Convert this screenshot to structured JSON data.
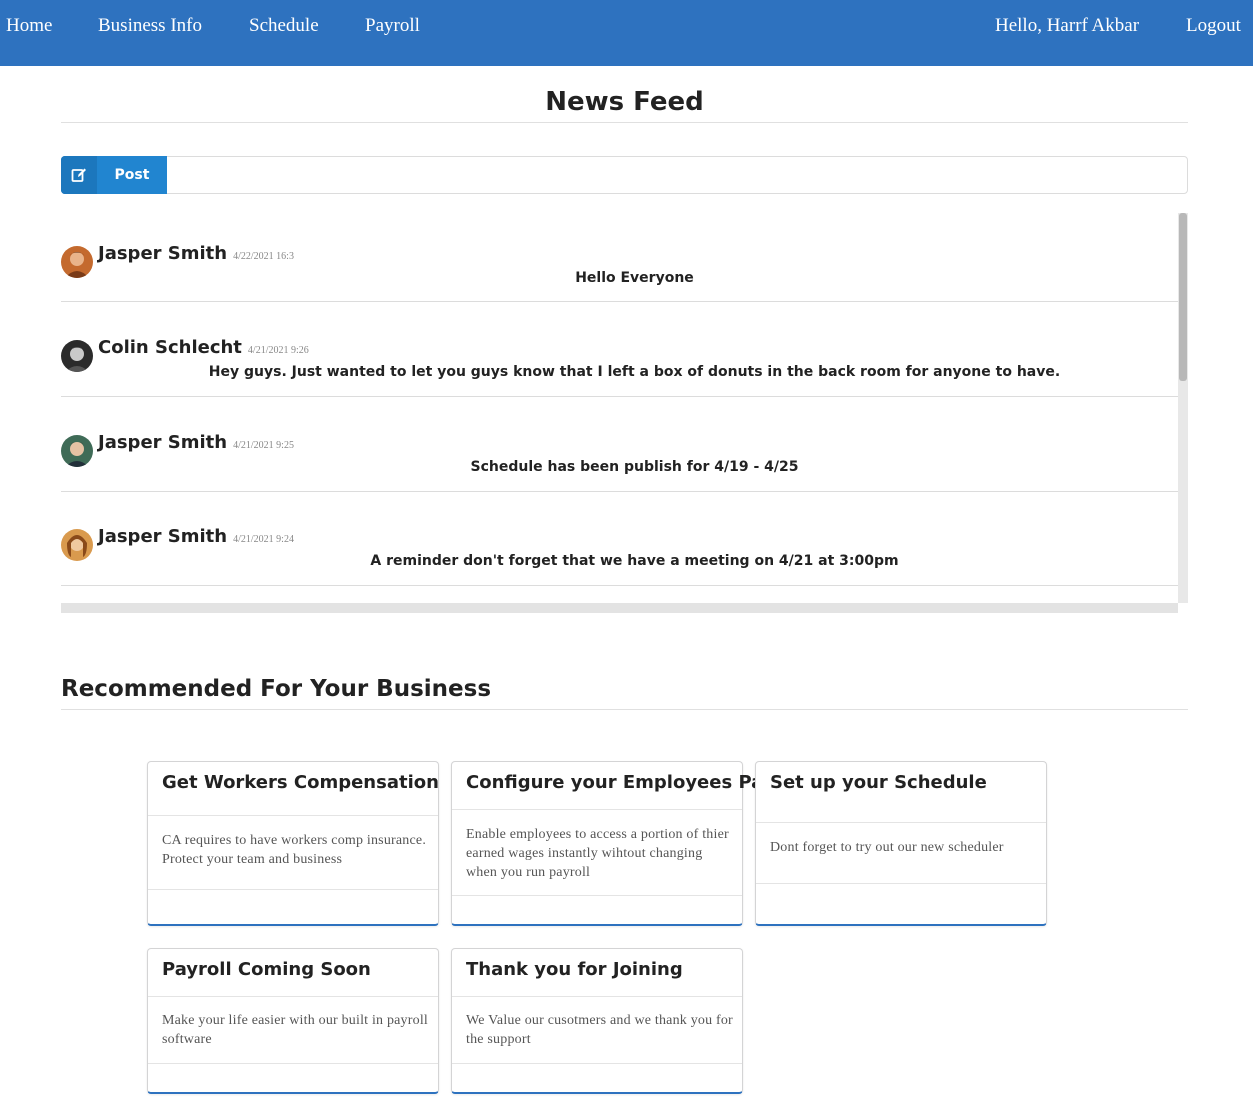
{
  "nav": {
    "home": "Home",
    "business_info": "Business Info",
    "schedule": "Schedule",
    "payroll": "Payroll",
    "greeting": "Hello, Harrf Akbar",
    "logout": "Logout"
  },
  "feed": {
    "title": "News Feed",
    "post_label": "Post",
    "posts": [
      {
        "author": "Jasper Smith",
        "time": "4/22/2021 16:3",
        "message": "Hello Everyone"
      },
      {
        "author": "Colin Schlecht",
        "time": "4/21/2021 9:26",
        "message": "Hey guys. Just wanted to let you guys know that I left a box of donuts in the back room for anyone to have."
      },
      {
        "author": "Jasper Smith",
        "time": "4/21/2021 9:25",
        "message": "Schedule has been publish for 4/19 - 4/25"
      },
      {
        "author": "Jasper Smith",
        "time": "4/21/2021 9:24",
        "message": "A reminder don't forget that we have a meeting on 4/21 at 3:00pm"
      }
    ]
  },
  "recommended": {
    "title": "Recommended For Your Business",
    "cards": [
      {
        "title": "Get Workers Compensation",
        "body": "CA requires to have workers comp insurance. Protect your team and business"
      },
      {
        "title": "Configure your Employees Pay",
        "body": "Enable employees to access a portion of thier earned wages instantly wihtout changing when you run payroll"
      },
      {
        "title": "Set up your Schedule",
        "body": "Dont forget to try out our new scheduler"
      },
      {
        "title": "Payroll Coming Soon",
        "body": "Make your life easier with our built in payroll software"
      },
      {
        "title": "Thank you for Joining",
        "body": "We Value our cusotmers and we thank you for the support"
      }
    ]
  },
  "colors": {
    "navbar": "#2e72bf",
    "post_button": "#2185d0",
    "card_accent": "#2e72bf"
  },
  "icons": {
    "post": "edit-icon",
    "avatar": "user-avatar"
  }
}
